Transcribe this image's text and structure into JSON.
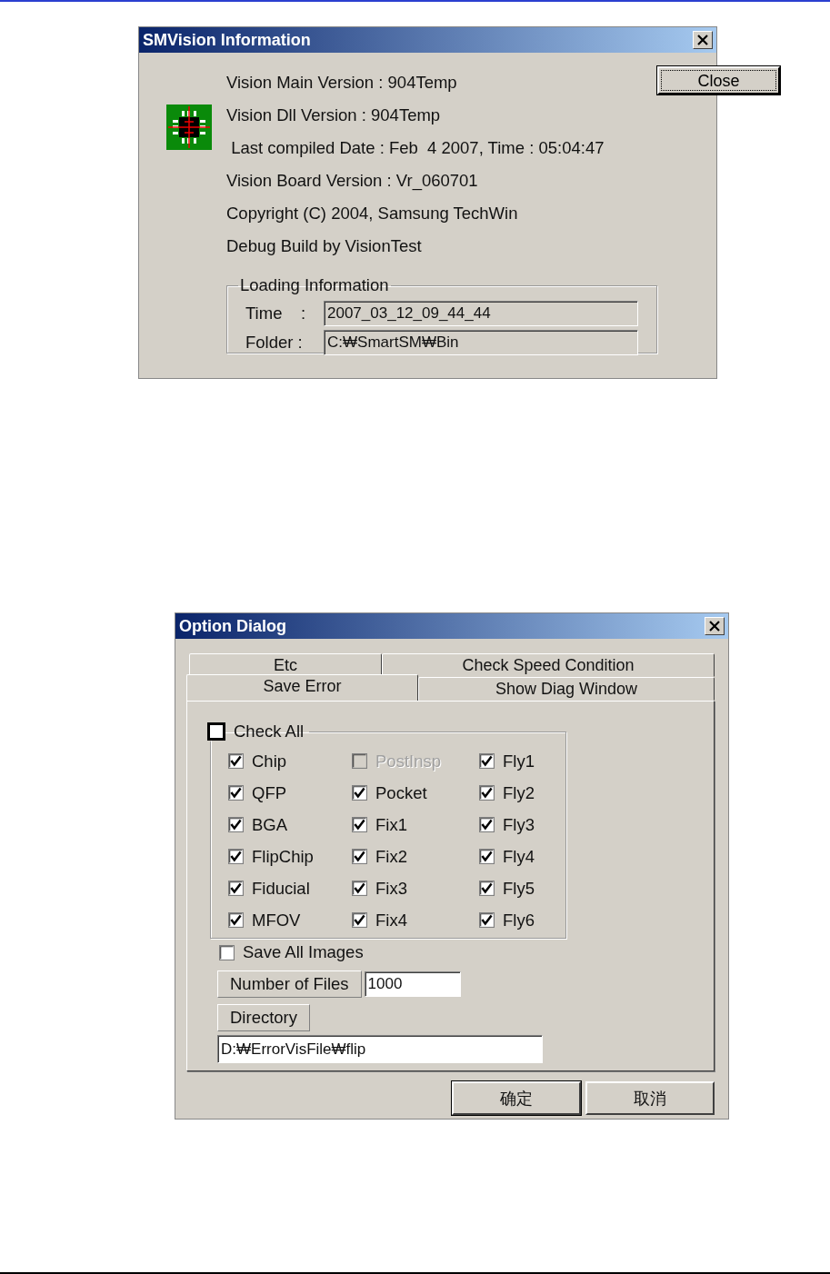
{
  "info_dialog": {
    "title": "SMVision Information",
    "close_button": "Close",
    "lines": [
      "Vision Main Version : 904Temp",
      "Vision Dll Version : 904Temp",
      " Last compiled Date : Feb  4 2007, Time : 05:04:47",
      "Vision Board Version : Vr_060701",
      "Copyright (C) 2004, Samsung TechWin",
      "Debug Build by VisionTest"
    ],
    "loading": {
      "legend": "Loading Information",
      "fields": [
        {
          "label": "Time    :",
          "value": "2007_03_12_09_44_44"
        },
        {
          "label": "Folder :",
          "value": "C:₩SmartSM₩Bin"
        }
      ]
    }
  },
  "option_dialog": {
    "title": "Option Dialog",
    "tab_rows": [
      [
        {
          "label": "Etc",
          "selected": false
        },
        {
          "label": "Check Speed Condition",
          "selected": false
        }
      ],
      [
        {
          "label": "Save Error",
          "selected": true
        },
        {
          "label": "Show Diag Window",
          "selected": false
        }
      ]
    ],
    "check_all": {
      "label": "Check All",
      "checked": false
    },
    "checks": [
      {
        "label": "Chip",
        "checked": true,
        "disabled": false
      },
      {
        "label": "PostInsp",
        "checked": false,
        "disabled": true
      },
      {
        "label": "Fly1",
        "checked": true,
        "disabled": false
      },
      {
        "label": "QFP",
        "checked": true,
        "disabled": false
      },
      {
        "label": "Pocket",
        "checked": true,
        "disabled": false
      },
      {
        "label": "Fly2",
        "checked": true,
        "disabled": false
      },
      {
        "label": "BGA",
        "checked": true,
        "disabled": false
      },
      {
        "label": "Fix1",
        "checked": true,
        "disabled": false
      },
      {
        "label": "Fly3",
        "checked": true,
        "disabled": false
      },
      {
        "label": "FlipChip",
        "checked": true,
        "disabled": false
      },
      {
        "label": "Fix2",
        "checked": true,
        "disabled": false
      },
      {
        "label": "Fly4",
        "checked": true,
        "disabled": false
      },
      {
        "label": "Fiducial",
        "checked": true,
        "disabled": false
      },
      {
        "label": "Fix3",
        "checked": true,
        "disabled": false
      },
      {
        "label": "Fly5",
        "checked": true,
        "disabled": false
      },
      {
        "label": "MFOV",
        "checked": true,
        "disabled": false
      },
      {
        "label": "Fix4",
        "checked": true,
        "disabled": false
      },
      {
        "label": "Fly6",
        "checked": true,
        "disabled": false
      }
    ],
    "save_all_images": {
      "label": "Save All Images",
      "checked": false
    },
    "number_of_files": {
      "label": "Number of Files",
      "value": "1000"
    },
    "directory": {
      "label": "Directory",
      "value": "D:₩ErrorVisFile₩flip"
    },
    "buttons": [
      {
        "label": "确定",
        "default": true
      },
      {
        "label": "取消",
        "default": false
      }
    ]
  }
}
